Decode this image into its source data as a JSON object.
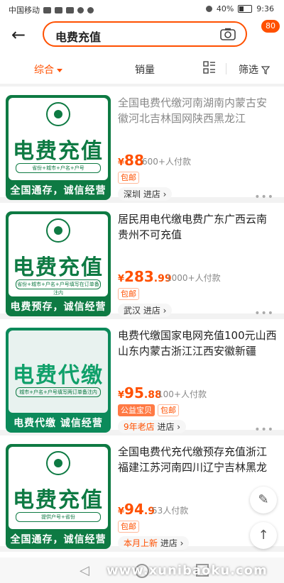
{
  "status_bar": {
    "carrier": "中国移动",
    "battery": "40%",
    "time": "9:36"
  },
  "search": {
    "query": "电费充值",
    "cart_count": "80"
  },
  "filter_bar": {
    "zonghe": "综合",
    "sales": "销量",
    "filter": "筛选"
  },
  "products": [
    {
      "title": "全国电费代缴河南湖南内蒙古安徽河北吉林国网陕西黑龙江",
      "price_int": "88",
      "price_dec": "",
      "paid": "600+人付款",
      "tags": [
        "包邮"
      ],
      "shop": "深圳",
      "shop_prefix": "",
      "enter": "进店 ›",
      "thumb": {
        "word": "电费充值",
        "sub": "省份+城市+户名+户号",
        "banner": "全国通存，诚信经营"
      }
    },
    {
      "title": "居民用电代缴电费广东广西云南贵州不可充值",
      "price_int": "283",
      "price_dec": ".99",
      "paid": "1000+人付款",
      "tags": [
        "包邮"
      ],
      "shop": "武汉",
      "shop_prefix": "",
      "enter": "进店 ›",
      "thumb": {
        "word": "电费充值",
        "sub": "省份+城市+户名+户号填写在订单备注内",
        "banner": "电费预存，诚信经营"
      }
    },
    {
      "title": "电费代缴国家电网充值100元山西山东内蒙古浙江江西安徽新疆",
      "price_int": "95",
      "price_dec": ".88",
      "paid": "100+人付款",
      "tags": [
        "公益宝贝",
        "包邮"
      ],
      "shop": "",
      "shop_prefix": "9年老店",
      "enter": "进店 ›",
      "thumb": {
        "word": "电费代缴",
        "sub": "城市+户名+户号填写两订单备注内",
        "banner": "电费代缴  诚信经营"
      }
    },
    {
      "title": "全国电费代充代缴预存充值浙江福建江苏河南四川辽宁吉林黑龙",
      "price_int": "94",
      "price_dec": ".9",
      "paid": "53人付款",
      "tags": [
        "包邮"
      ],
      "shop": "",
      "shop_prefix": "本月上新",
      "enter": "进店 ›",
      "thumb": {
        "word": "电费充值",
        "sub": "提供户号+省份",
        "banner": "全国通存，诚信经营"
      }
    }
  ],
  "price_symbol": "¥",
  "watermark": "www.xunibaoku.com",
  "colors": {
    "accent": "#ff5000",
    "grid_green": "#0e7a43"
  }
}
